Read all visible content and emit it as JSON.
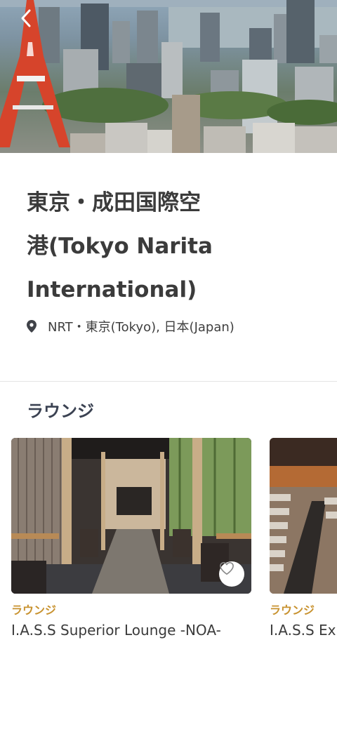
{
  "header": {
    "back_icon": "chevron-left-icon"
  },
  "airport": {
    "name": "東京・成田国際空港(Tokyo Narita International)",
    "name_lines": [
      "東京・成田国際空",
      "港(Tokyo Narita",
      "International)"
    ],
    "location": "NRT・東京(Tokyo), 日本(Japan)",
    "location_icon": "map-pin-icon"
  },
  "lounges_section": {
    "title": "ラウンジ",
    "items": [
      {
        "category": "ラウンジ",
        "name": "I.A.S.S Superior Lounge -NOA-",
        "favorite_icon": "heart-outline-icon"
      },
      {
        "category": "ラウンジ",
        "name": "I.A.S.S Ex"
      }
    ]
  },
  "colors": {
    "title_text": "#3b3b3b",
    "category_accent": "#c8922f",
    "section_title": "#3b4252",
    "divider": "#e4e4e4"
  }
}
